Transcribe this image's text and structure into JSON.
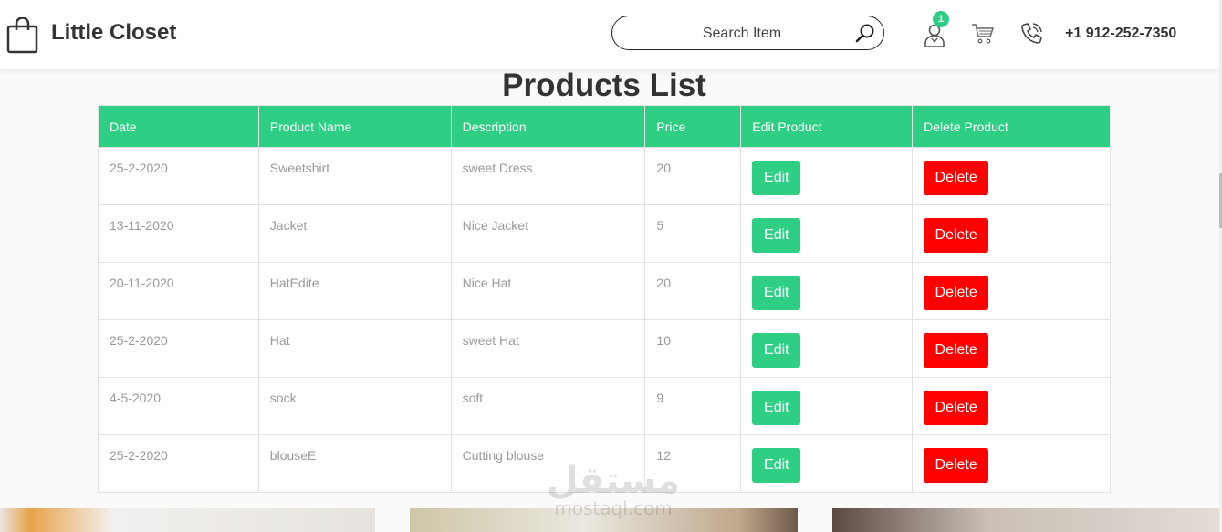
{
  "header": {
    "brand": "Little Closet",
    "search_placeholder": "Search Item",
    "cart_badge": "1",
    "phone": "+1 912-252-7350"
  },
  "page": {
    "title": "Products List"
  },
  "table": {
    "columns": [
      "Date",
      "Product Name",
      "Description",
      "Price",
      "Edit Product",
      "Delete Product"
    ],
    "edit_label": "Edit",
    "delete_label": "Delete",
    "rows": [
      {
        "date": "25-2-2020",
        "name": "Sweetshirt",
        "description": "sweet Dress",
        "price": "20"
      },
      {
        "date": "13-11-2020",
        "name": "Jacket",
        "description": "Nice Jacket",
        "price": "5"
      },
      {
        "date": "20-11-2020",
        "name": "HatEdite",
        "description": "Nice Hat",
        "price": "20"
      },
      {
        "date": "25-2-2020",
        "name": "Hat",
        "description": "sweet Hat",
        "price": "10"
      },
      {
        "date": "4-5-2020",
        "name": "sock",
        "description": "soft",
        "price": "9"
      },
      {
        "date": "25-2-2020",
        "name": "blouseE",
        "description": "Cutting blouse",
        "price": "12"
      }
    ]
  },
  "colors": {
    "accent": "#2ecf85",
    "danger": "#ff0000",
    "text": "#333333",
    "muted": "#999999"
  },
  "icons": [
    "shopping-bag-icon",
    "search-icon",
    "user-icon",
    "cart-icon",
    "phone-icon"
  ],
  "watermark": {
    "arabic": "مستقل",
    "latin": "mostaql.com"
  }
}
